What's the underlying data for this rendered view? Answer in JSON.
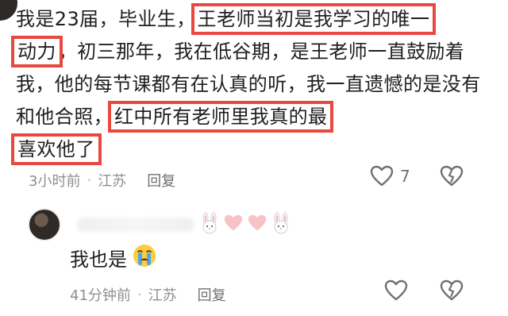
{
  "comment": {
    "segments": [
      {
        "text": "我是23届，毕业生，",
        "hl": false
      },
      {
        "text": "王老师当初是我学习的唯一",
        "hl": true
      },
      {
        "text": "动力",
        "hl": true
      },
      {
        "text": "，初三那年，我在低谷期，是王老师一直鼓励着我，他的每节课都有在认真的听，我一直遗憾的是没有和他合照，",
        "hl": false
      },
      {
        "text": "红中所有老师里我真的最",
        "hl": true
      },
      {
        "text": "喜欢他了",
        "hl": true
      }
    ],
    "time": "3小时前",
    "separator": "·",
    "location": "江苏",
    "reply_label": "回复",
    "like_count": "7",
    "icons": {
      "like": "heart-outline-icon",
      "dislike": "broken-heart-icon"
    }
  },
  "reply": {
    "decor_emojis": [
      "bunny-icon",
      "pink-heart-icon",
      "pink-heart-icon",
      "bunny-icon"
    ],
    "text": "我也是",
    "emoji": "crying-face-icon",
    "time": "41分钟前",
    "separator": "·",
    "location": "江苏",
    "reply_label": "回复",
    "icons": {
      "like": "heart-outline-icon",
      "dislike": "broken-heart-icon"
    }
  },
  "colors": {
    "highlight": "#e8483f",
    "meta": "#8f8f8f",
    "text": "#1f1f1f"
  }
}
